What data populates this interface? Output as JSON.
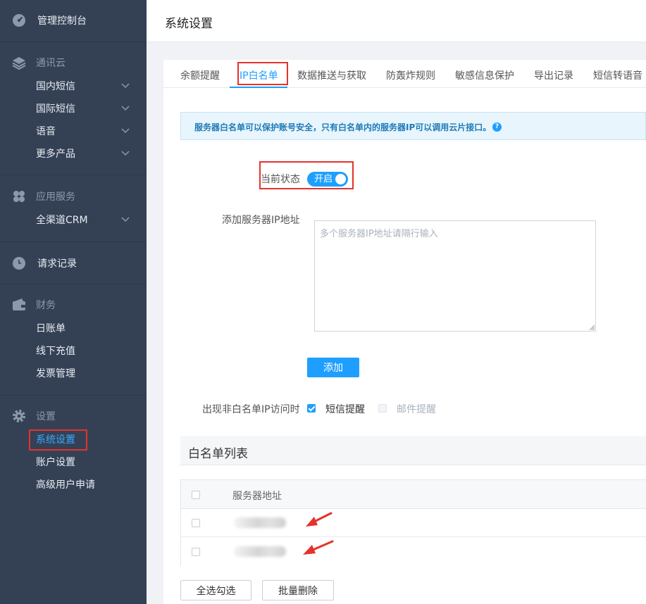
{
  "sidebar": {
    "dashboard": "管理控制台",
    "groups": [
      {
        "title": "通讯云",
        "items": [
          "国内短信",
          "国际短信",
          "语音",
          "更多产品"
        ]
      },
      {
        "title": "应用服务",
        "items": [
          "全渠道CRM"
        ]
      },
      {
        "title": "请求记录"
      },
      {
        "title": "财务",
        "items": [
          "日账单",
          "线下充值",
          "发票管理"
        ]
      },
      {
        "title": "设置",
        "items": [
          "系统设置",
          "账户设置",
          "高级用户申请"
        ]
      }
    ]
  },
  "header": {
    "title": "系统设置"
  },
  "tabs": [
    "余额提醒",
    "IP白名单",
    "数据推送与获取",
    "防轰炸规则",
    "敏感信息保护",
    "导出记录",
    "短信转语音"
  ],
  "active_tab": "IP白名单",
  "notice": {
    "text": "服务器白名单可以保护账号安全，只有白名单内的服务器IP可以调用云片接口。",
    "help_icon": "question-icon"
  },
  "status": {
    "label": "当前状态",
    "switch_text": "开启",
    "on": true
  },
  "ip_input": {
    "label": "添加服务器IP地址",
    "placeholder": "多个服务器IP地址请隔行输入",
    "value": ""
  },
  "add_button": "添加",
  "notify": {
    "label": "出现非白名单IP访问时",
    "sms": {
      "label": "短信提醒",
      "checked": true
    },
    "email": {
      "label": "邮件提醒",
      "checked": false,
      "disabled": true
    }
  },
  "list": {
    "title": "白名单列表",
    "column": "服务器地址",
    "rows": [
      "",
      ""
    ]
  },
  "actions": {
    "select_all": "全选勾选",
    "batch_delete": "批量删除"
  },
  "colors": {
    "sidebar_bg": "#344155",
    "accent": "#1e9fff",
    "highlight_red": "#e5322d"
  }
}
